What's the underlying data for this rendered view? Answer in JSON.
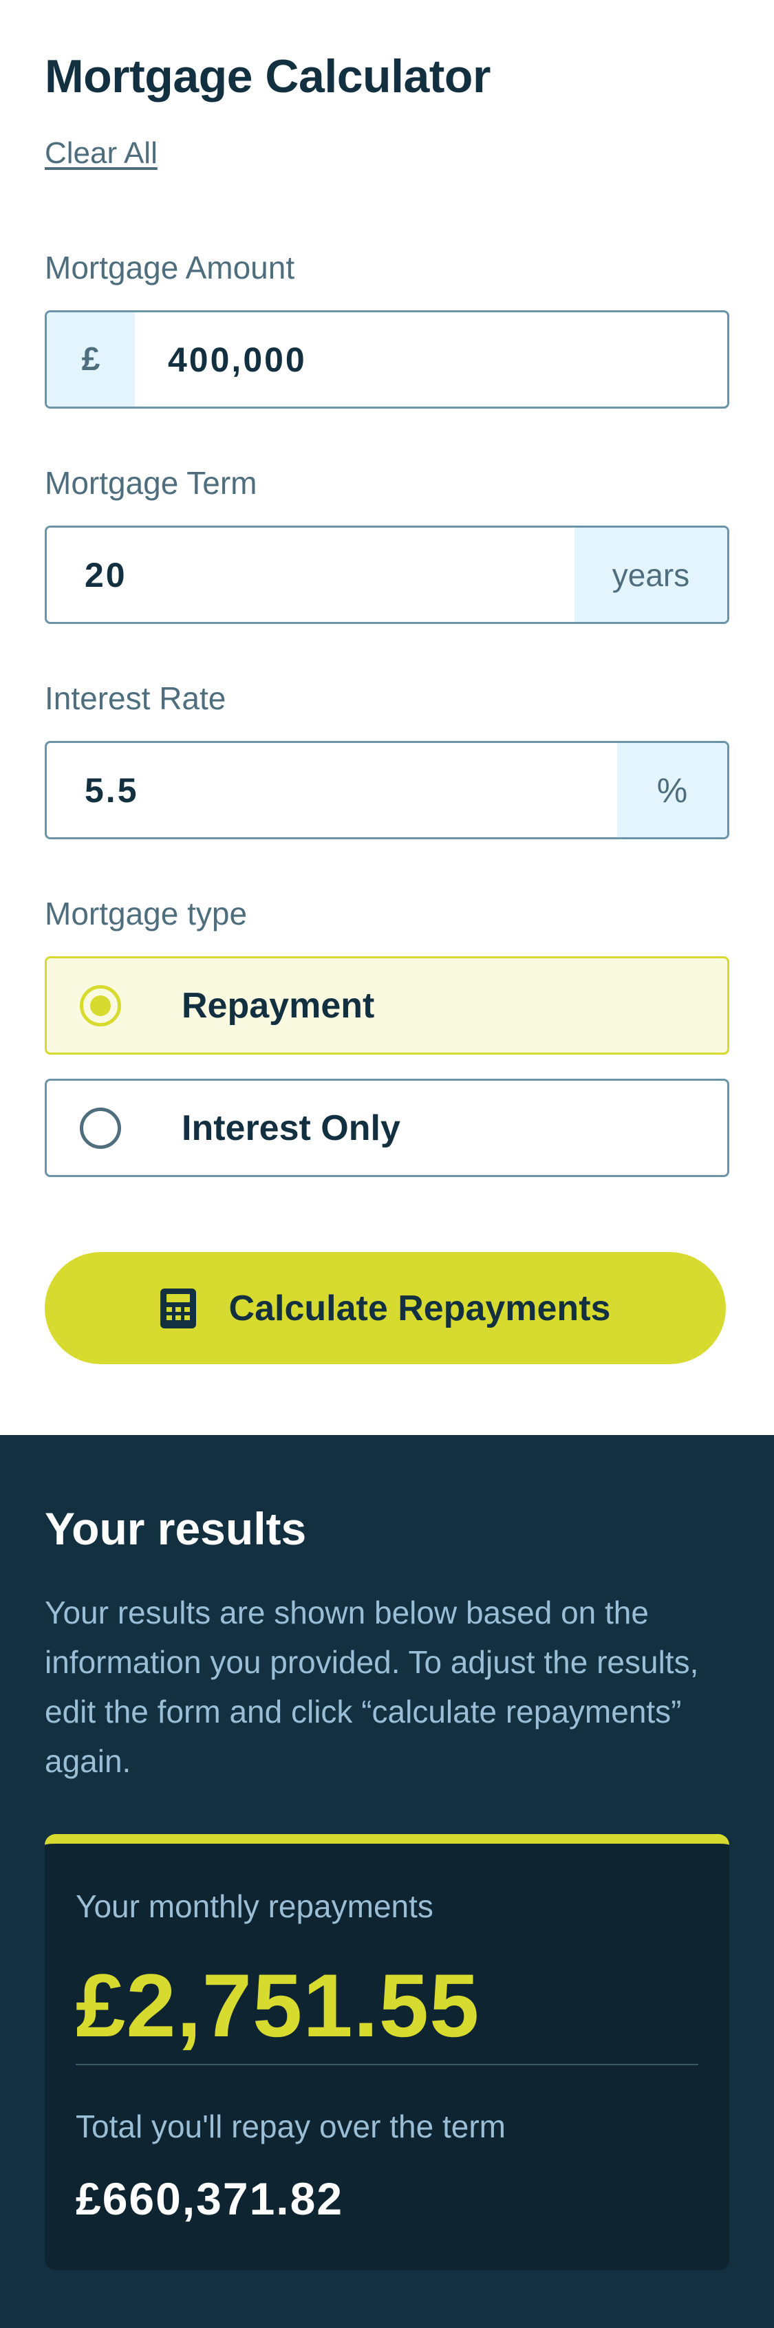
{
  "header": {
    "title": "Mortgage Calculator",
    "clear_all": "Clear All"
  },
  "form": {
    "amount": {
      "label": "Mortgage Amount",
      "prefix": "£",
      "value": "400,000"
    },
    "term": {
      "label": "Mortgage Term",
      "value": "20",
      "suffix": "years"
    },
    "rate": {
      "label": "Interest Rate",
      "value": "5.5",
      "suffix": "%"
    },
    "type": {
      "label": "Mortgage type",
      "options": [
        {
          "label": "Repayment",
          "selected": true
        },
        {
          "label": "Interest Only",
          "selected": false
        }
      ]
    },
    "calculate_button": "Calculate Repayments"
  },
  "results": {
    "title": "Your results",
    "description": "Your results are shown below based on the information you provided. To adjust the results, edit the form and click “calculate repayments” again.",
    "monthly_label": "Your monthly repayments",
    "monthly_value": "£2,751.55",
    "total_label": "Total you'll repay over the term",
    "total_value": "£660,371.82"
  },
  "colors": {
    "navy": "#133041",
    "slate": "#4e6e7e",
    "lime": "#d8db2f",
    "light_blue": "#e4f4fd",
    "card_bg": "#0e2431"
  },
  "icons": {
    "calculator": "calculator-icon"
  }
}
